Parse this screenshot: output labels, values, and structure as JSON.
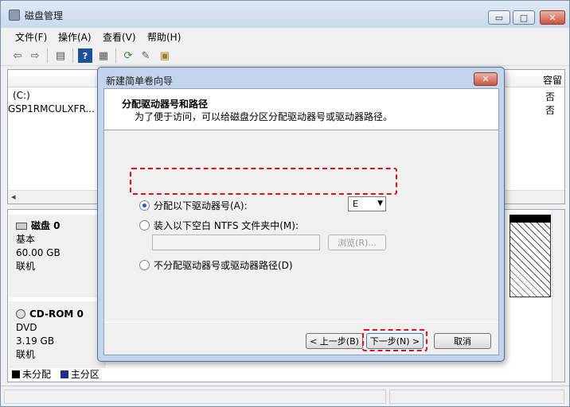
{
  "app": {
    "title": "磁盘管理"
  },
  "window_controls": {
    "minimize": "▭",
    "maximize": "□",
    "close": "✕"
  },
  "menu": {
    "file": "文件(F)",
    "action": "操作(A)",
    "view": "查看(V)",
    "help": "帮助(H)"
  },
  "toolbar": {
    "back_icon": "⇦",
    "forward_icon": "⇨",
    "console_icon": "▤",
    "help_icon": "?",
    "list_icon": "▦",
    "refresh_icon": "⟳",
    "properties_icon": "✎",
    "export_icon": "▣"
  },
  "volume_list": {
    "capacity_header": "容留",
    "rows": [
      {
        "name": "(C:)",
        "capacity": "否"
      },
      {
        "name": "GSP1RMCULXFR...",
        "capacity": "否"
      }
    ],
    "scroll_left": "◂"
  },
  "disks": [
    {
      "name": "磁盘 0",
      "type": "基本",
      "size": "60.00 GB",
      "status": "联机"
    },
    {
      "name": "CD-ROM 0",
      "type": "DVD",
      "size": "3.19 GB",
      "status": "联机"
    }
  ],
  "legend": [
    {
      "label": "未分配",
      "color": "#000000"
    },
    {
      "label": "主分区",
      "color": "#1c2d8f"
    }
  ],
  "wizard": {
    "title": "新建简单卷向导",
    "close": "✕",
    "heading": "分配驱动器号和路径",
    "subheading": "为了便于访问，可以给磁盘分区分配驱动器号或驱动器路径。",
    "option_assign": "分配以下驱动器号(A):",
    "option_mount": "装入以下空白 NTFS 文件夹中(M):",
    "option_none": "不分配驱动器号或驱动器路径(D)",
    "selected_option": "assign",
    "drive_letter": "E",
    "browse": "浏览(R)...",
    "back": "< 上一步(B)",
    "next": "下一步(N) >",
    "cancel": "取消"
  },
  "colors": {
    "highlight": "#e0101b",
    "title_gradient": "#c9d9ee"
  }
}
